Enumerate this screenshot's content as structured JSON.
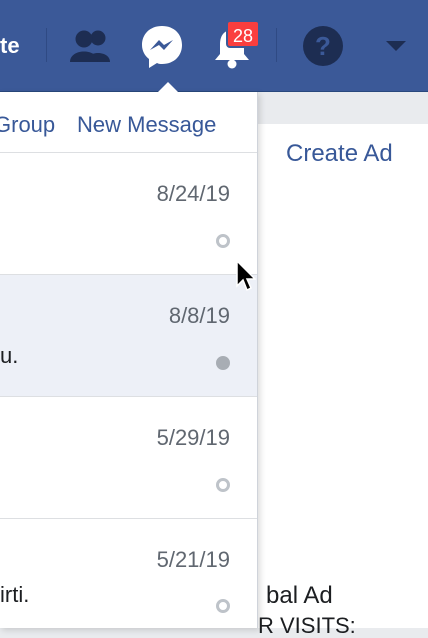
{
  "navbar": {
    "partial_label": "te",
    "notifications_badge": "28"
  },
  "icons": {
    "friends": "friend-requests-icon",
    "messenger": "messenger-icon",
    "notifications": "notifications-bell-icon",
    "help": "help-icon",
    "menu": "caret-down-icon",
    "cursor": "mouse-pointer-icon"
  },
  "dropdown": {
    "header": {
      "group_label": "Group",
      "separator": "·",
      "new_message_label": "New Message"
    },
    "conversations": [
      {
        "date": "8/24/19",
        "snippet": "",
        "status": "read"
      },
      {
        "date": "8/8/19",
        "snippet": "u.",
        "status": "unread"
      },
      {
        "date": "5/29/19",
        "snippet": "",
        "status": "read"
      },
      {
        "date": "5/21/19",
        "snippet": "irti.",
        "status": "read"
      }
    ]
  },
  "right_pane": {
    "create_ad_label": "Create Ad",
    "bottom_text_1": "bal Ad",
    "bottom_text_2": "R VISITS:"
  },
  "colors": {
    "nav_blue": "#3b5998",
    "link_blue": "#385898",
    "badge_red": "#fa3e3e",
    "selected_row": "#edf0f7"
  }
}
